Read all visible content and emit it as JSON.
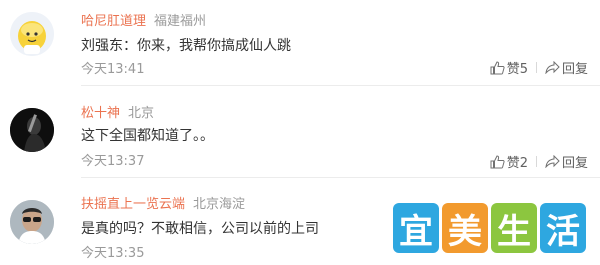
{
  "comments": [
    {
      "username": "哈尼肛道理",
      "location": "福建福州",
      "text": "刘强东：你来，我帮你搞成仙人跳",
      "time": "今天13:41",
      "like_label": "赞5",
      "reply_label": "回复",
      "avatar_icon": "yellow-cartoon-avatar"
    },
    {
      "username": "松十神",
      "location": "北京",
      "text": "这下全国都知道了。。",
      "time": "今天13:37",
      "like_label": "赞2",
      "reply_label": "回复",
      "avatar_icon": "dark-figure-avatar"
    },
    {
      "username": "扶摇直上一览云端",
      "location": "北京海淀",
      "text": "是真的吗？不敢相信，公司以前的上司",
      "time": "今天13:35",
      "like_label": "",
      "reply_label": "",
      "avatar_icon": "man-sunglasses-avatar"
    }
  ],
  "watermark": {
    "chars": [
      "宜",
      "美",
      "生",
      "活"
    ],
    "colors": [
      "#2ea7e0",
      "#f29a2e",
      "#8cc63f",
      "#2ea7e0"
    ]
  },
  "colors": {
    "username": "#eb7350",
    "meta": "#9a9a9a",
    "text": "#333333"
  }
}
